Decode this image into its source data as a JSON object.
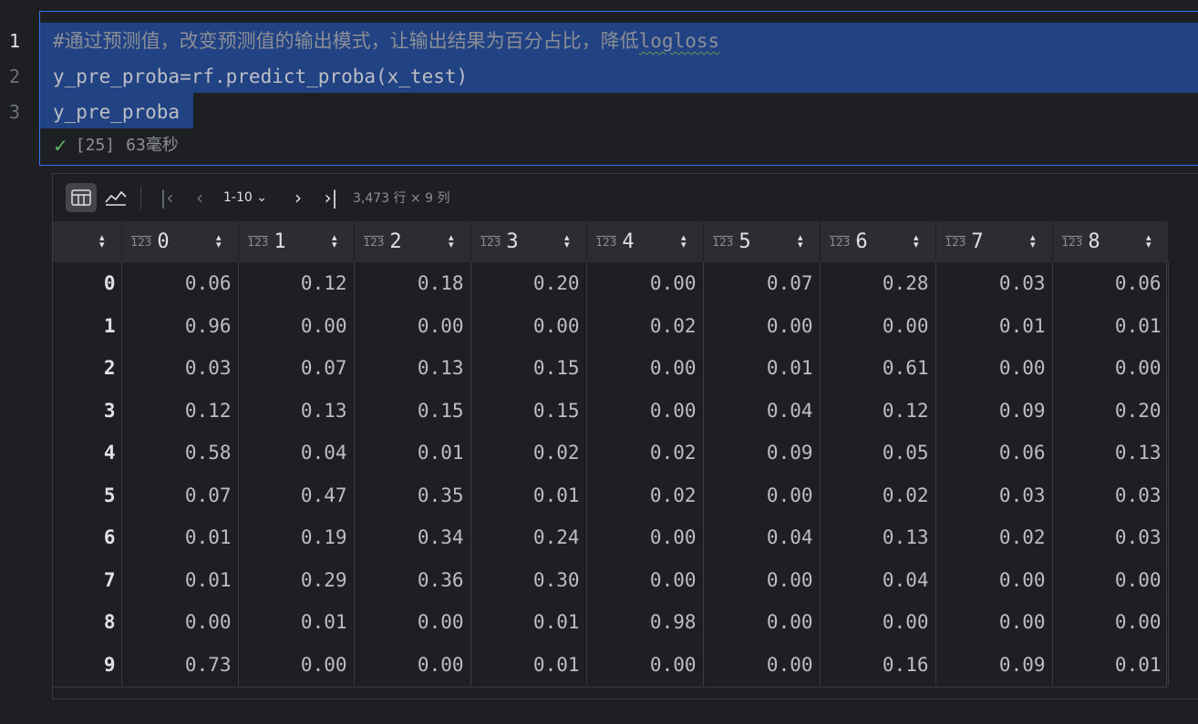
{
  "gutter": [
    "1",
    "2",
    "3"
  ],
  "code": {
    "line1_comment": "#通过预测值，改变预测值的输出模式，让输出结果为百分占比，降低",
    "line1_squiggle": "logloss",
    "line2": "y_pre_proba=rf.predict_proba(x_test)",
    "line3": "y_pre_proba"
  },
  "execution": {
    "count": "[25]",
    "duration": "63毫秒"
  },
  "toolbar": {
    "range": "1-10",
    "dims": "3,473 行 × 9 列"
  },
  "table": {
    "columns": [
      "0",
      "1",
      "2",
      "3",
      "4",
      "5",
      "6",
      "7",
      "8"
    ],
    "type_badge": "123",
    "rows": [
      {
        "idx": "0",
        "vals": [
          "0.06",
          "0.12",
          "0.18",
          "0.20",
          "0.00",
          "0.07",
          "0.28",
          "0.03",
          "0.06"
        ]
      },
      {
        "idx": "1",
        "vals": [
          "0.96",
          "0.00",
          "0.00",
          "0.00",
          "0.02",
          "0.00",
          "0.00",
          "0.01",
          "0.01"
        ]
      },
      {
        "idx": "2",
        "vals": [
          "0.03",
          "0.07",
          "0.13",
          "0.15",
          "0.00",
          "0.01",
          "0.61",
          "0.00",
          "0.00"
        ]
      },
      {
        "idx": "3",
        "vals": [
          "0.12",
          "0.13",
          "0.15",
          "0.15",
          "0.00",
          "0.04",
          "0.12",
          "0.09",
          "0.20"
        ]
      },
      {
        "idx": "4",
        "vals": [
          "0.58",
          "0.04",
          "0.01",
          "0.02",
          "0.02",
          "0.09",
          "0.05",
          "0.06",
          "0.13"
        ]
      },
      {
        "idx": "5",
        "vals": [
          "0.07",
          "0.47",
          "0.35",
          "0.01",
          "0.02",
          "0.00",
          "0.02",
          "0.03",
          "0.03"
        ]
      },
      {
        "idx": "6",
        "vals": [
          "0.01",
          "0.19",
          "0.34",
          "0.24",
          "0.00",
          "0.04",
          "0.13",
          "0.02",
          "0.03"
        ]
      },
      {
        "idx": "7",
        "vals": [
          "0.01",
          "0.29",
          "0.36",
          "0.30",
          "0.00",
          "0.00",
          "0.04",
          "0.00",
          "0.00"
        ]
      },
      {
        "idx": "8",
        "vals": [
          "0.00",
          "0.01",
          "0.00",
          "0.01",
          "0.98",
          "0.00",
          "0.00",
          "0.00",
          "0.00"
        ]
      },
      {
        "idx": "9",
        "vals": [
          "0.73",
          "0.00",
          "0.00",
          "0.01",
          "0.00",
          "0.00",
          "0.16",
          "0.09",
          "0.01"
        ]
      }
    ]
  },
  "colors": {
    "accent": "#3574f0",
    "selection": "#214283",
    "success": "#5fb865"
  }
}
